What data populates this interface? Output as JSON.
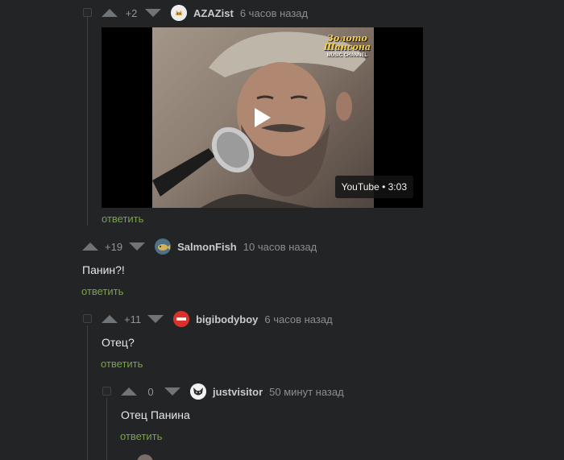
{
  "colors": {
    "background": "#222426",
    "reply": "#7aa34b",
    "thread_line": "#3c4043"
  },
  "comments": [
    {
      "rating": "+2",
      "username": "AZAZist",
      "time": "6 часов назад",
      "text": "",
      "reply": "ответить",
      "avatar_icon": "cat-avatar-icon"
    },
    {
      "rating": "+19",
      "username": "SalmonFish",
      "time": "10 часов назад",
      "text": "Панин?!",
      "reply": "ответить",
      "avatar_icon": "fish-avatar-icon"
    },
    {
      "rating": "+11",
      "username": "bigibodyboy",
      "time": "6 часов назад",
      "text": "Отец?",
      "reply": "ответить",
      "avatar_icon": "no-entry-avatar-icon"
    },
    {
      "rating": "0",
      "username": "justvisitor",
      "time": "50 минут назад",
      "text": "Отец Панина",
      "reply": "ответить",
      "avatar_icon": "fox-avatar-icon"
    }
  ],
  "video": {
    "badge": "YouTube • 3:03",
    "logo_line1": "Золото",
    "logo_line2": "Шансона",
    "logo_line3": "MUSIC CHANNEL"
  }
}
